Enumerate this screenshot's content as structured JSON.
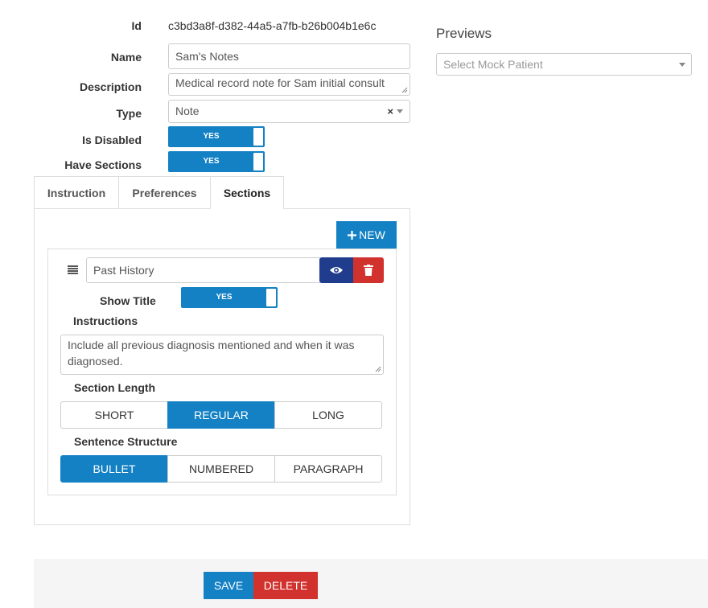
{
  "form": {
    "id_label": "Id",
    "id_value": "c3bd3a8f-d382-44a5-a7fb-b26b004b1e6c",
    "name_label": "Name",
    "name_value": "Sam's Notes",
    "description_label": "Description",
    "description_value": "Medical record note for Sam initial consult",
    "type_label": "Type",
    "type_value": "Note",
    "type_clear": "×",
    "disabled_label": "Is Disabled",
    "disabled_toggle": "YES",
    "sections_label": "Have Sections",
    "sections_toggle": "YES"
  },
  "tabs": [
    {
      "label": "Instruction"
    },
    {
      "label": "Preferences"
    },
    {
      "label": "Sections",
      "active": true
    }
  ],
  "sections_panel": {
    "new_button": "NEW",
    "section": {
      "title_value": "Past History",
      "show_title_label": "Show Title",
      "show_title_toggle": "YES",
      "instructions_label": "Instructions",
      "instructions_value": "Include all previous diagnosis mentioned and when it was diagnosed.",
      "length_label": "Section Length",
      "length_options": [
        "SHORT",
        "REGULAR",
        "LONG"
      ],
      "length_selected": "REGULAR",
      "structure_label": "Sentence Structure",
      "structure_options": [
        "BULLET",
        "NUMBERED",
        "PARAGRAPH"
      ],
      "structure_selected": "BULLET"
    }
  },
  "previews": {
    "title": "Previews",
    "select_placeholder": "Select Mock Patient"
  },
  "footer": {
    "save_label": "SAVE",
    "delete_label": "DELETE"
  },
  "colors": {
    "primary": "#1481c4",
    "danger": "#d2322d",
    "navy": "#1f3d8c"
  },
  "icons": [
    "drag-handle-icon",
    "eye-icon",
    "trash-icon",
    "plus-icon",
    "chevron-down-icon",
    "clear-icon"
  ]
}
